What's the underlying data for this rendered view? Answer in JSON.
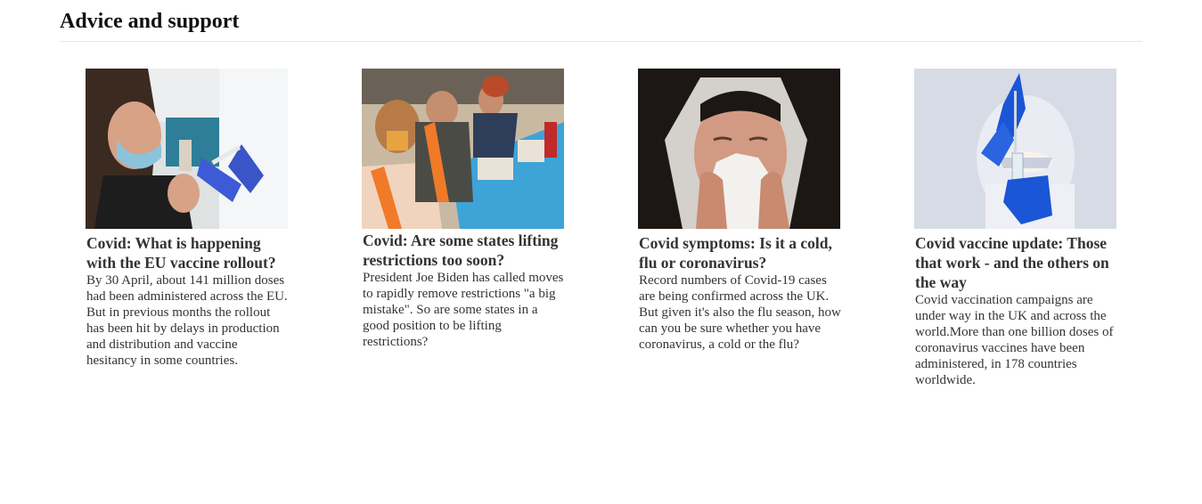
{
  "section": {
    "title": "Advice and support"
  },
  "cards": [
    {
      "image": "woman-receiving-vaccine-photo",
      "title": "Covid: What is happening with the EU vaccine rollout?",
      "text": "By 30 April, about 141 million doses had been administered across the EU. But in previous months the rollout has been hit by delays in production and distribution and vaccine hesitancy in some countries."
    },
    {
      "image": "vaccination-center-crowd-photo",
      "title": "Covid: Are some states lifting restrictions too soon?",
      "text": "President Joe Biden has called moves to rapidly remove restrictions \"a big mistake\". So are some states in a good position to be lifting restrictions?"
    },
    {
      "image": "woman-sneezing-tissue-photo",
      "title": "Covid symptoms: Is it a cold, flu or coronavirus?",
      "text": "Record numbers of Covid-19 cases are being confirmed across the UK. But given it's also the flu season, how can you be sure whether you have coronavirus, a cold or the flu?"
    },
    {
      "image": "scientist-holding-vaccine-vial-photo",
      "title": "Covid vaccine update: Those that work - and the others on the way",
      "text": "Covid vaccination campaigns are under way in the UK and across the world.More than one billion doses of coronavirus vaccines have been administered, in 178 countries worldwide."
    }
  ]
}
